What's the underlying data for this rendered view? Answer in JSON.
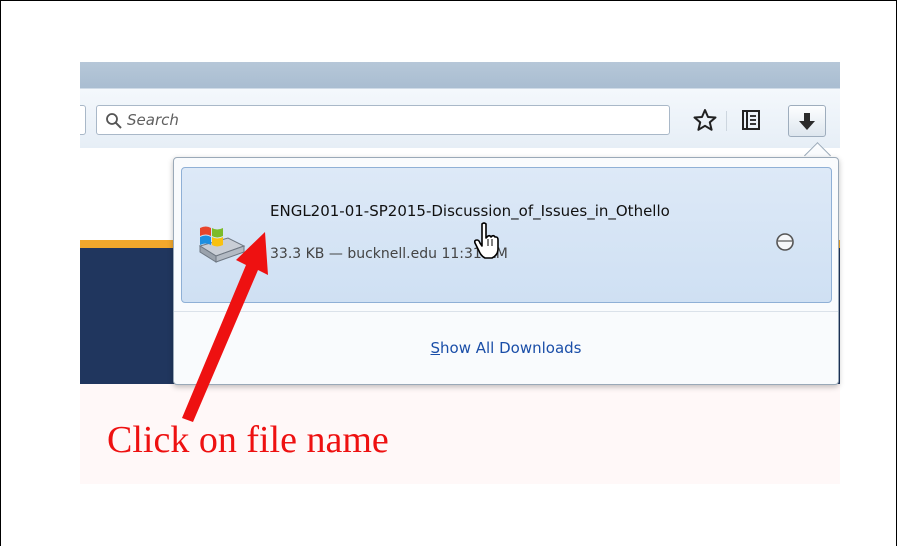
{
  "toolbar": {
    "search_placeholder": "Search",
    "search_value": "",
    "icons": [
      "search-icon",
      "bookmark-star-icon",
      "reading-list-icon",
      "download-arrow-icon"
    ]
  },
  "downloads_panel": {
    "item": {
      "file_name": "ENGL201-01-SP2015-Discussion_of_Issues_in_Othello",
      "size": "33.3 KB",
      "separator": "—",
      "source": "bucknell.edu",
      "time": "11:31 AM",
      "icon": "windows-file-icon",
      "action_icon": "open-folder-circle-icon"
    },
    "show_all_prefix": "S",
    "show_all_rest": "how All Downloads"
  },
  "annotation": {
    "text": "Click on file name",
    "color": "#ee1111"
  },
  "colors": {
    "accent_orange": "#f2a82c",
    "navy": "#20365e",
    "link_blue": "#1a4ea8"
  }
}
